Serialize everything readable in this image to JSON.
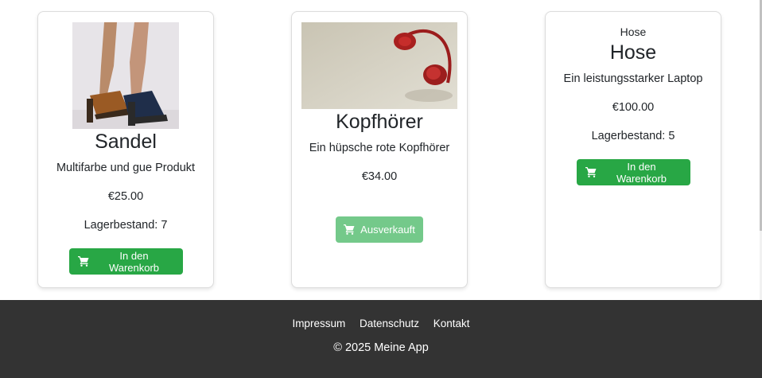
{
  "products": [
    {
      "image_icon": "sandals-photo",
      "title": "Sandel",
      "description": "Multifarbe und gue Produkt",
      "price": "€25.00",
      "stock": "Lagerbestand: 7",
      "button_label": "In den Warenkorb",
      "button_icon": "cart-icon"
    },
    {
      "image_icon": "headphones-photo",
      "title": "Kopfhörer",
      "description": "Ein hüpsche rote Kopfhörer",
      "price": "€34.00",
      "button_label": "Ausverkauft",
      "button_icon": "cart-icon"
    },
    {
      "subtitle": "Hose",
      "title": "Hose",
      "description": "Ein leistungsstarker Laptop",
      "price": "€100.00",
      "stock": "Lagerbestand: 5",
      "button_label": "In den Warenkorb",
      "button_icon": "cart-icon"
    }
  ],
  "footer": {
    "links": [
      "Impressum",
      "Datenschutz",
      "Kontakt"
    ],
    "copyright": "© 2025 Meine App"
  },
  "colors": {
    "button_green": "#28a745",
    "button_disabled": "#74c98a",
    "footer_bg": "#333333"
  }
}
